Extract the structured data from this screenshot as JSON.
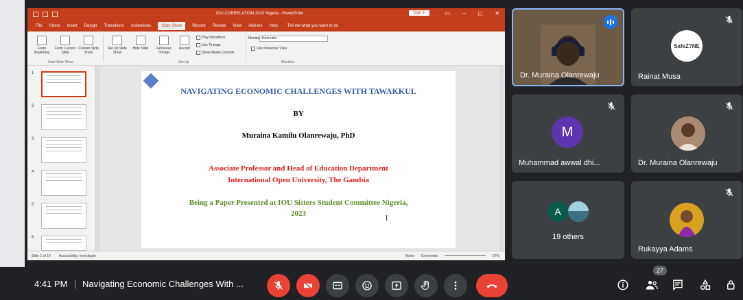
{
  "powerpoint": {
    "window_title": "IOU CORRELATION 2023 Nigeria - PowerPoint",
    "sign_in": "Sign in",
    "tabs": [
      {
        "label": "File"
      },
      {
        "label": "Home"
      },
      {
        "label": "Insert"
      },
      {
        "label": "Design"
      },
      {
        "label": "Transitions"
      },
      {
        "label": "Animations"
      },
      {
        "label": "Slide Show",
        "active": true
      },
      {
        "label": "Record"
      },
      {
        "label": "Review"
      },
      {
        "label": "View"
      },
      {
        "label": "Add-ins"
      },
      {
        "label": "Help"
      }
    ],
    "tell_me": "Tell me what you want to do",
    "ribbon": {
      "from_beginning": "From Beginning",
      "from_current": "From Current Slide",
      "custom_show": "Custom Slide Show",
      "group_start": "Start Slide Show",
      "set_up": "Set Up Slide Show",
      "hide_slide": "Hide Slide",
      "rehearse": "Rehearse Timings",
      "record": "Record",
      "play_narrations": "Play Narrations",
      "use_timings": "Use Timings",
      "show_media": "Show Media Controls",
      "group_setup": "Set Up",
      "monitor_label": "Monitor:",
      "monitor_value": "Automatic",
      "presenter_view": "Use Presenter View",
      "group_monitors": "Monitors"
    },
    "thumbnails": [
      "1",
      "2",
      "3",
      "4",
      "5",
      "6"
    ],
    "slide": {
      "title": "NAVIGATING ECONOMIC CHALLENGES WITH TAWAKKUL",
      "by": "BY",
      "author": "Muraina Kamilu Olanrewaju, PhD",
      "position_line1": "Associate Professor and Head of Education Department",
      "position_line2": "International Open University, The Gambia",
      "paper_line1": "Being a Paper Presented at IOU Sisters Student Committee Nigeria,",
      "paper_line2": "2023",
      "cursor": "I"
    },
    "status": {
      "slide_count": "Slide 1 of 14",
      "accessibility": "Accessibility: Investigate",
      "notes": "Notes",
      "comments": "Comments",
      "zoom": "67%"
    }
  },
  "participants": [
    {
      "name": "Dr. Muraina Olanrewaju",
      "speaking": true
    },
    {
      "name": "Rainat Musa",
      "logo_text": "SafeZ?NE",
      "muted": true
    },
    {
      "name": "Muhammad awwal dhi...",
      "initial": "M",
      "muted": true
    },
    {
      "name": "Dr. Muraina Olanrewaju",
      "muted": true
    },
    {
      "name": "19 others",
      "initial": "A"
    },
    {
      "name": "Rukayya Adams",
      "muted": true
    }
  ],
  "bottom_bar": {
    "time": "4:41 PM",
    "separator": "|",
    "meeting_title": "Navigating Economic Challenges With ...",
    "people_count": "27"
  },
  "colors": {
    "ppt_accent": "#c43e1c",
    "meet_bg": "#202124",
    "tile_bg": "#3c4043",
    "end_call": "#ea4335",
    "avatar_m": "#5e35b1",
    "avatar_a": "#0b5b4a"
  }
}
